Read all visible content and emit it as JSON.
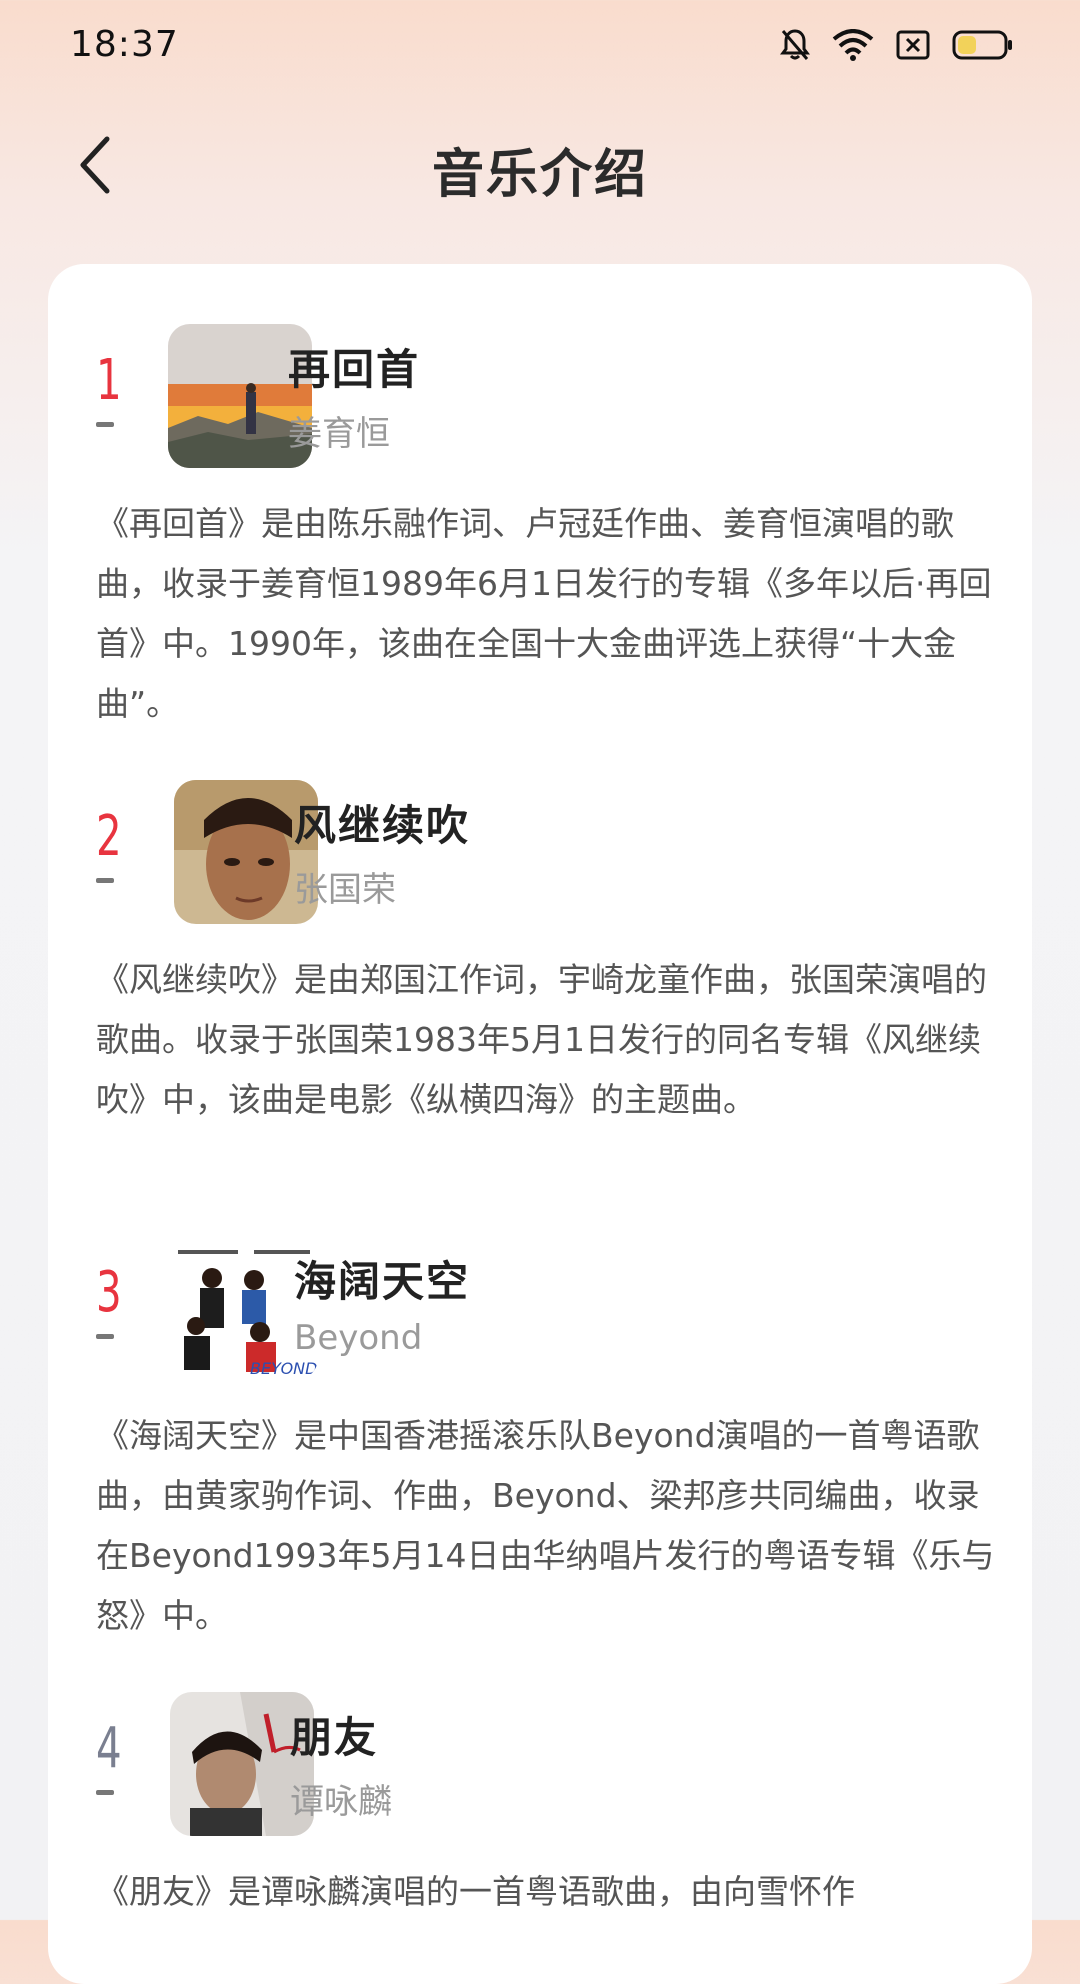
{
  "status_bar": {
    "time": "18:37",
    "icons": [
      "bell-muted-icon",
      "wifi-icon",
      "sim-off-icon",
      "battery-icon"
    ]
  },
  "header": {
    "title": "音乐介绍",
    "back_icon": "chevron-left-icon"
  },
  "colors": {
    "rank_top": "#e8343f",
    "rank_other": "#7a7f90"
  },
  "songs": [
    {
      "rank": "1",
      "title": "再回首",
      "artist": "姜育恒",
      "description": "《再回首》是由陈乐融作词、卢冠廷作曲、姜育恒演唱的歌曲，收录于姜育恒1989年6月1日发行的专辑《多年以后·再回首》中。1990年，该曲在全国十大金曲评选上获得“十大金曲”。"
    },
    {
      "rank": "2",
      "title": "风继续吹",
      "artist": "张国荣",
      "description": "《风继续吹》是由郑国江作词，宇崎龙童作曲，张国荣演唱的歌曲。收录于张国荣1983年5月1日发行的同名专辑《风继续吹》中，该曲是电影《纵横四海》的主题曲。"
    },
    {
      "rank": "3",
      "title": "海阔天空",
      "artist": "Beyond",
      "description": "《海阔天空》是中国香港摇滚乐队Beyond演唱的一首粤语歌曲，由黄家驹作词、作曲，Beyond、梁邦彦共同编曲，收录在Beyond1993年5月14日由华纳唱片发行的粤语专辑《乐与怒》中。"
    },
    {
      "rank": "4",
      "title": "朋友",
      "artist": "谭咏麟",
      "description": "《朋友》是谭咏麟演唱的一首粤语歌曲，由向雪怀作"
    }
  ]
}
